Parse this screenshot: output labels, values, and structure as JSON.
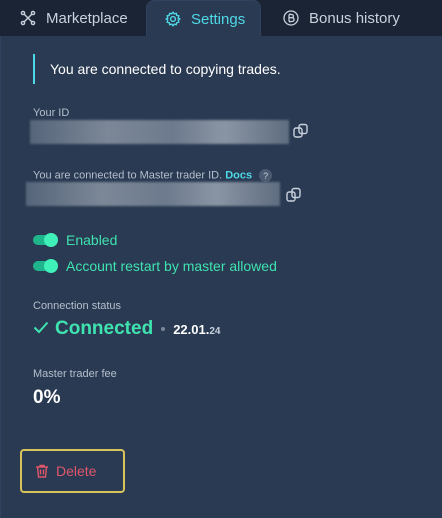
{
  "tabs": {
    "marketplace": {
      "label": "Marketplace",
      "icon": "marketplace-icon"
    },
    "settings": {
      "label": "Settings",
      "icon": "gear-icon",
      "active": true
    },
    "bonus_history": {
      "label": "Bonus history",
      "icon": "bitcoin-icon"
    }
  },
  "notice": {
    "text": "You are connected to copying trades."
  },
  "your_id": {
    "label": "Your ID",
    "copy_icon": "copy-icon"
  },
  "master": {
    "label": "You are connected to Master trader ID.",
    "docs_link": "Docs",
    "help": "?",
    "copy_icon": "copy-icon"
  },
  "toggles": [
    {
      "label": "Enabled",
      "on": true
    },
    {
      "label": "Account restart by master allowed",
      "on": true
    }
  ],
  "connection": {
    "label": "Connection status",
    "status": "Connected",
    "date": "22.01.",
    "year": "24"
  },
  "fee": {
    "label": "Master trader fee",
    "value": "0%"
  },
  "delete_button": {
    "label": "Delete",
    "icon": "trash-icon"
  },
  "colors": {
    "accent": "#4fd8e6",
    "success": "#3fe3b0",
    "danger": "#e0566a",
    "focus_outline": "#d8c35a",
    "panel": "#2a3a52"
  }
}
